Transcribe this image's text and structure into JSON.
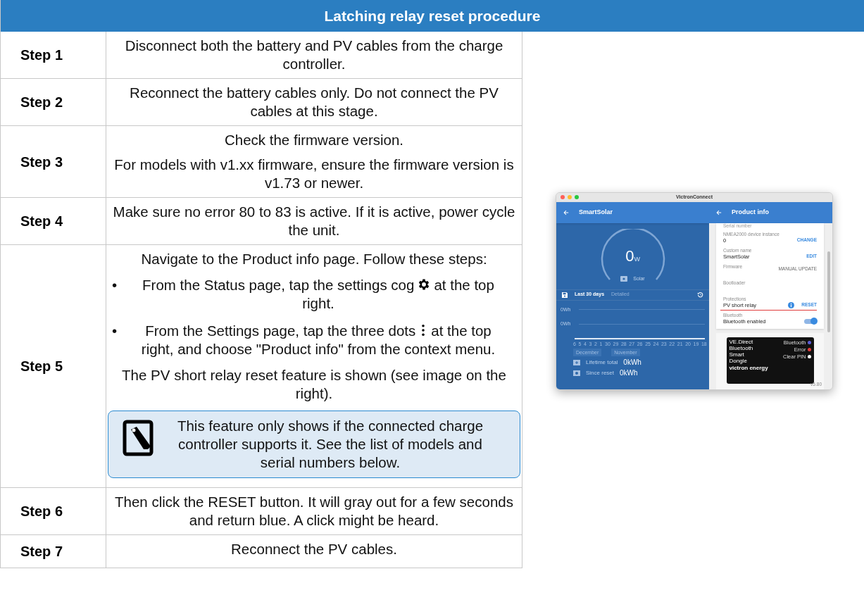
{
  "title": "Latching relay reset procedure",
  "steps": [
    {
      "label": "Step 1",
      "content": [
        {
          "kind": "text",
          "text": "Disconnect both the battery and PV cables from the charge controller."
        }
      ]
    },
    {
      "label": "Step 2",
      "content": [
        {
          "kind": "text",
          "text": "Reconnect the battery cables only. Do not connect the PV cables at this stage."
        }
      ]
    },
    {
      "label": "Step 3",
      "content": [
        {
          "kind": "text",
          "text": "Check the firmware version."
        },
        {
          "kind": "text",
          "text": "For models with v1.xx firmware, ensure the firmware version is v1.73 or newer."
        }
      ]
    },
    {
      "label": "Step 4",
      "content": [
        {
          "kind": "text",
          "text": "Make sure no error 80 to 83 is active. If it is active, power cycle the unit."
        }
      ]
    },
    {
      "label": "Step 5",
      "content": [
        {
          "kind": "text",
          "text": "Navigate to the Product info page. Follow these steps:"
        },
        {
          "kind": "cog_bullet",
          "bullet": "•",
          "before": "From the Status page, tap the settings cog",
          "after": "at the top right."
        },
        {
          "kind": "dots_bullet",
          "bullet": "•",
          "before": "From the Settings page, tap the three dots",
          "after": "at the top right, and choose \"Product info\" from the context menu."
        },
        {
          "kind": "text",
          "text": "The PV short relay reset feature is shown (see image on the right)."
        },
        {
          "kind": "note",
          "text": "This feature only shows if the connected charge controller supports it. See the list of models and serial numbers below."
        }
      ]
    },
    {
      "label": "Step 6",
      "content": [
        {
          "kind": "text",
          "text": "Then click the RESET button. It will gray out for a few seconds and return blue. A click might be heard."
        }
      ]
    },
    {
      "label": "Step 7",
      "content": [
        {
          "kind": "text",
          "text": "Reconnect the PV cables."
        }
      ]
    }
  ],
  "app_screenshot": {
    "window_title": "VictronConnect",
    "left": {
      "title": "SmartSolar",
      "power_value": "0",
      "power_unit": "W",
      "source": "Solar",
      "range": "Last 30 days",
      "range_alt": "Detailed",
      "y_labels": [
        "0Wh",
        "0Wh"
      ],
      "x_labels": [
        "6",
        "5",
        "4",
        "3",
        "2",
        "1",
        "30",
        "29",
        "28",
        "27",
        "26",
        "25",
        "24",
        "23",
        "22",
        "21",
        "20",
        "19",
        "18"
      ],
      "months": [
        "December",
        "November"
      ],
      "totals": [
        {
          "label": "Lifetime total",
          "value": "0kWh"
        },
        {
          "label": "Since reset",
          "value": "0kWh"
        }
      ]
    },
    "right": {
      "title": "Product info",
      "cut_label": "Serial number",
      "rows": [
        {
          "kind": "action",
          "label": "NMEA2000 device instance",
          "value": "0",
          "action": "CHANGE"
        },
        {
          "kind": "action",
          "label": "Custom name",
          "value": "SmartSolar",
          "action": "EDIT"
        },
        {
          "kind": "action",
          "label": "Firmware",
          "action": "MANUAL UPDATE"
        },
        {
          "kind": "plain",
          "label": "Bootloader"
        },
        {
          "kind": "reset",
          "label": "Protections",
          "value": "PV short relay",
          "action": "RESET"
        },
        {
          "kind": "toggle",
          "label": "Bluetooth",
          "value": "Bluetooth enabled",
          "on": true
        }
      ],
      "dongle": {
        "name_lines": [
          "VE.Direct",
          "Bluetooth",
          "Smart",
          "Dongle"
        ],
        "leds": [
          {
            "label": "Bluetooth",
            "color": "#5b5bd6"
          },
          {
            "label": "Error",
            "color": "#e03c3c"
          },
          {
            "label": "Clear PIN",
            "color": "#ffffff"
          }
        ],
        "brand": "victron energy"
      },
      "version": "v5.80"
    }
  }
}
